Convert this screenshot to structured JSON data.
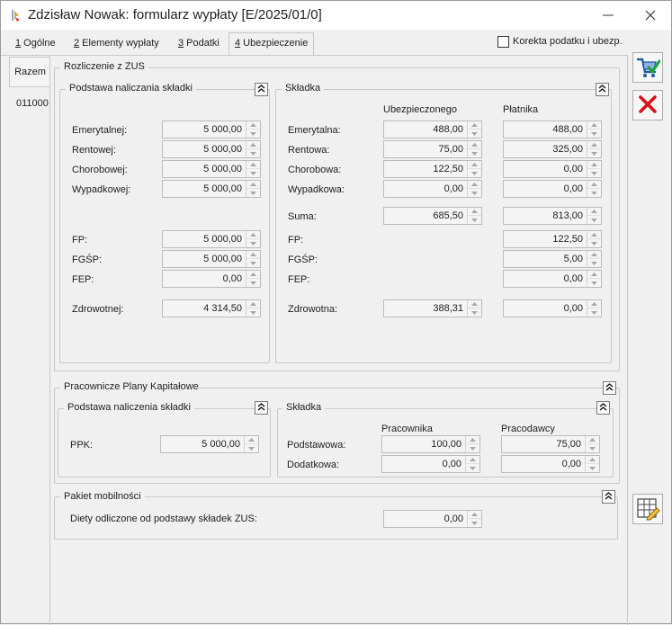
{
  "window": {
    "title": "Zdzisław Nowak: formularz wypłaty [E/2025/01/0]",
    "minimize_label": "—",
    "close_label": "✕"
  },
  "tabs": [
    {
      "num": "1",
      "label": " Ogólne"
    },
    {
      "num": "2",
      "label": " Elementy wypłaty"
    },
    {
      "num": "3",
      "label": " Podatki"
    },
    {
      "num": "4",
      "label": " Ubezpieczenie"
    }
  ],
  "korekta_label": "Korekta podatku i ubezp.",
  "side": {
    "tab": "Razem",
    "code": "011000"
  },
  "zus": {
    "title": "Rozliczenie z ZUS",
    "podstawa": {
      "title": "Podstawa naliczania składki",
      "rows": [
        {
          "label": "Emerytalnej:",
          "value": "5 000,00"
        },
        {
          "label": "Rentowej:",
          "value": "5 000,00"
        },
        {
          "label": "Chorobowej:",
          "value": "5 000,00"
        },
        {
          "label": "Wypadkowej:",
          "value": "5 000,00"
        },
        {
          "label": "FP:",
          "value": "5 000,00"
        },
        {
          "label": "FGŚP:",
          "value": "5 000,00"
        },
        {
          "label": "FEP:",
          "value": "0,00"
        },
        {
          "label": "Zdrowotnej:",
          "value": "4 314,50"
        }
      ]
    },
    "skladka": {
      "title": "Składka",
      "col1": "Ubezpieczonego",
      "col2": "Płatnika",
      "rows": [
        {
          "label": "Emerytalna:",
          "v1": "488,00",
          "v2": "488,00"
        },
        {
          "label": "Rentowa:",
          "v1": "75,00",
          "v2": "325,00"
        },
        {
          "label": "Chorobowa:",
          "v1": "122,50",
          "v2": "0,00"
        },
        {
          "label": "Wypadkowa:",
          "v1": "0,00",
          "v2": "0,00"
        },
        {
          "label": "Suma:",
          "v1": "685,50",
          "v2": "813,00"
        },
        {
          "label": "FP:",
          "v1": null,
          "v2": "122,50"
        },
        {
          "label": "FGŚP:",
          "v1": null,
          "v2": "5,00"
        },
        {
          "label": "FEP:",
          "v1": null,
          "v2": "0,00"
        },
        {
          "label": "Zdrowotna:",
          "v1": "388,31",
          "v2": "0,00"
        }
      ]
    }
  },
  "ppk": {
    "title": "Pracownicze Plany Kapitałowe",
    "podstawa": {
      "title": "Podstawa naliczenia składki",
      "label": "PPK:",
      "value": "5 000,00"
    },
    "skladka": {
      "title": "Składka",
      "col1": "Pracownika",
      "col2": "Pracodawcy",
      "rows": [
        {
          "label": "Podstawowa:",
          "v1": "100,00",
          "v2": "75,00"
        },
        {
          "label": "Dodatkowa:",
          "v1": "0,00",
          "v2": "0,00"
        }
      ]
    }
  },
  "mobilnosci": {
    "title": "Pakiet mobilności",
    "label": "Diety odliczone od podstawy składek ZUS:",
    "value": "0,00"
  },
  "colors": {
    "accent": "#1e5aa8",
    "cancel_red": "#d4151b",
    "confirm_green": "#1aa33a"
  }
}
